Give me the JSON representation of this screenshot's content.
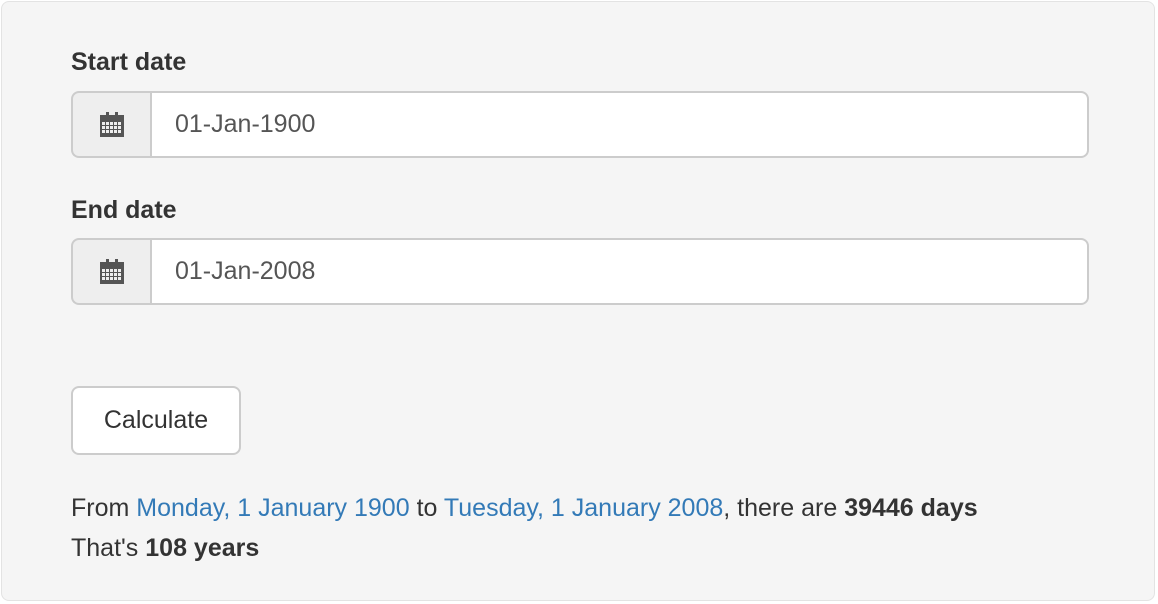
{
  "form": {
    "start": {
      "label": "Start date",
      "value": "01-Jan-1900",
      "icon": "calendar-icon"
    },
    "end": {
      "label": "End date",
      "value": "01-Jan-2008",
      "icon": "calendar-icon"
    },
    "calculate_label": "Calculate"
  },
  "result": {
    "from_prefix": "From",
    "start_link": "Monday, 1 January 1900",
    "to_word": "to",
    "end_link": "Tuesday, 1 January 2008",
    "there_are": ", there are",
    "days": "39446 days",
    "thats": "That's",
    "years": "108 years"
  },
  "colors": {
    "link": "#337ab7",
    "panel_bg": "#f5f5f5",
    "addon_bg": "#eeeeee",
    "border": "#cccccc",
    "text": "#333333"
  }
}
